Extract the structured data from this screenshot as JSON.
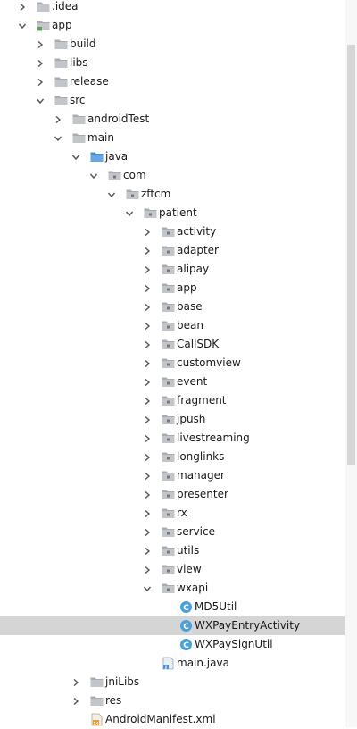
{
  "tree": [
    {
      "label": ".idea",
      "depth": 1,
      "icon": "folder-icon",
      "chevron": "right"
    },
    {
      "label": "app",
      "depth": 1,
      "icon": "module-folder-icon",
      "chevron": "down"
    },
    {
      "label": "build",
      "depth": 2,
      "icon": "folder-icon",
      "chevron": "right"
    },
    {
      "label": "libs",
      "depth": 2,
      "icon": "folder-icon",
      "chevron": "right"
    },
    {
      "label": "release",
      "depth": 2,
      "icon": "folder-icon",
      "chevron": "right"
    },
    {
      "label": "src",
      "depth": 2,
      "icon": "folder-icon",
      "chevron": "down"
    },
    {
      "label": "androidTest",
      "depth": 3,
      "icon": "folder-icon",
      "chevron": "right"
    },
    {
      "label": "main",
      "depth": 3,
      "icon": "folder-icon",
      "chevron": "down"
    },
    {
      "label": "java",
      "depth": 4,
      "icon": "source-folder-icon",
      "chevron": "down"
    },
    {
      "label": "com",
      "depth": 5,
      "icon": "package-icon",
      "chevron": "down"
    },
    {
      "label": "zftcm",
      "depth": 6,
      "icon": "package-icon",
      "chevron": "down"
    },
    {
      "label": "patient",
      "depth": 7,
      "icon": "package-icon",
      "chevron": "down"
    },
    {
      "label": "activity",
      "depth": 8,
      "icon": "package-icon",
      "chevron": "right"
    },
    {
      "label": "adapter",
      "depth": 8,
      "icon": "package-icon",
      "chevron": "right"
    },
    {
      "label": "alipay",
      "depth": 8,
      "icon": "package-icon",
      "chevron": "right"
    },
    {
      "label": "app",
      "depth": 8,
      "icon": "package-icon",
      "chevron": "right"
    },
    {
      "label": "base",
      "depth": 8,
      "icon": "package-icon",
      "chevron": "right"
    },
    {
      "label": "bean",
      "depth": 8,
      "icon": "package-icon",
      "chevron": "right"
    },
    {
      "label": "CallSDK",
      "depth": 8,
      "icon": "package-icon",
      "chevron": "right"
    },
    {
      "label": "customview",
      "depth": 8,
      "icon": "package-icon",
      "chevron": "right"
    },
    {
      "label": "event",
      "depth": 8,
      "icon": "package-icon",
      "chevron": "right"
    },
    {
      "label": "fragment",
      "depth": 8,
      "icon": "package-icon",
      "chevron": "right"
    },
    {
      "label": "jpush",
      "depth": 8,
      "icon": "package-icon",
      "chevron": "right"
    },
    {
      "label": "livestreaming",
      "depth": 8,
      "icon": "package-icon",
      "chevron": "right"
    },
    {
      "label": "longlinks",
      "depth": 8,
      "icon": "package-icon",
      "chevron": "right"
    },
    {
      "label": "manager",
      "depth": 8,
      "icon": "package-icon",
      "chevron": "right"
    },
    {
      "label": "presenter",
      "depth": 8,
      "icon": "package-icon",
      "chevron": "right"
    },
    {
      "label": "rx",
      "depth": 8,
      "icon": "package-icon",
      "chevron": "right"
    },
    {
      "label": "service",
      "depth": 8,
      "icon": "package-icon",
      "chevron": "right"
    },
    {
      "label": "utils",
      "depth": 8,
      "icon": "package-icon",
      "chevron": "right"
    },
    {
      "label": "view",
      "depth": 8,
      "icon": "package-icon",
      "chevron": "right"
    },
    {
      "label": "wxapi",
      "depth": 8,
      "icon": "package-icon",
      "chevron": "down"
    },
    {
      "label": "MD5Util",
      "depth": 9,
      "icon": "java-class-icon",
      "chevron": "none"
    },
    {
      "label": "WXPayEntryActivity",
      "depth": 9,
      "icon": "java-class-icon",
      "chevron": "none",
      "selected": true
    },
    {
      "label": "WXPaySignUtil",
      "depth": 9,
      "icon": "java-class-icon",
      "chevron": "none"
    },
    {
      "label": "main.java",
      "depth": 8,
      "icon": "java-file-icon",
      "chevron": "none"
    },
    {
      "label": "jniLibs",
      "depth": 4,
      "icon": "folder-icon",
      "chevron": "right"
    },
    {
      "label": "res",
      "depth": 4,
      "icon": "folder-icon",
      "chevron": "right"
    },
    {
      "label": "AndroidManifest.xml",
      "depth": 4,
      "icon": "xml-file-icon",
      "chevron": "none"
    }
  ],
  "colors": {
    "selection": "#d5d5d5",
    "folder": "#a9adb3",
    "source_folder": "#64a6e6",
    "class_icon": "#4aa0d8",
    "chevron": "#555555"
  }
}
